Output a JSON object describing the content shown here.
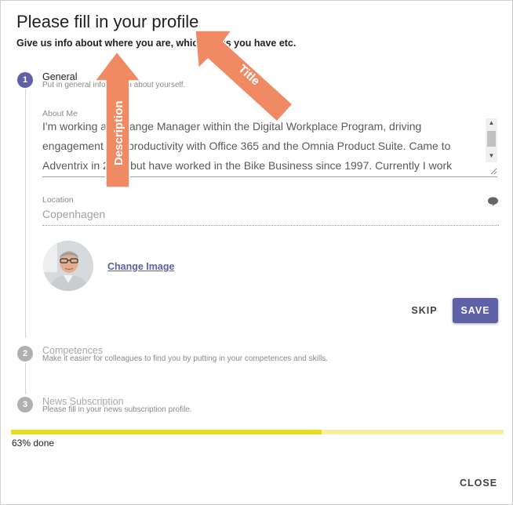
{
  "dialog": {
    "title": "Please fill in your profile",
    "description": "Give us info about where you are, which skills you have etc."
  },
  "steps": [
    {
      "number": "1",
      "title": "General",
      "subtitle": "Put in general information about yourself."
    },
    {
      "number": "2",
      "title": "Competences",
      "subtitle": "Make it easier for colleagues to find you by putting in your competences and skills."
    },
    {
      "number": "3",
      "title": "News Subscription",
      "subtitle": "Please fill in your news subscription profile."
    }
  ],
  "general": {
    "about_label": "About Me",
    "about_text": "I'm working as Change Manager within the Digital Workplace Program, driving engagement and productivity with Office 365 and the Omnia Product Suite. Came to Adventrix in 2016 but have worked in the Bike Business since 1997. Currently I work",
    "location_label": "Location",
    "location_value": "Copenhagen",
    "change_image_label": "Change Image",
    "skip_label": "SKIP",
    "save_label": "SAVE"
  },
  "progress": {
    "percent": 63,
    "label": "63% done"
  },
  "footer": {
    "close_label": "CLOSE"
  },
  "annotations": {
    "description_callout": "Description",
    "title_callout": "Title"
  },
  "colors": {
    "accent": "#5e61a8",
    "progress_fill": "#e6dd23",
    "progress_track": "#f6f0a0",
    "callout": "#f08a64"
  }
}
